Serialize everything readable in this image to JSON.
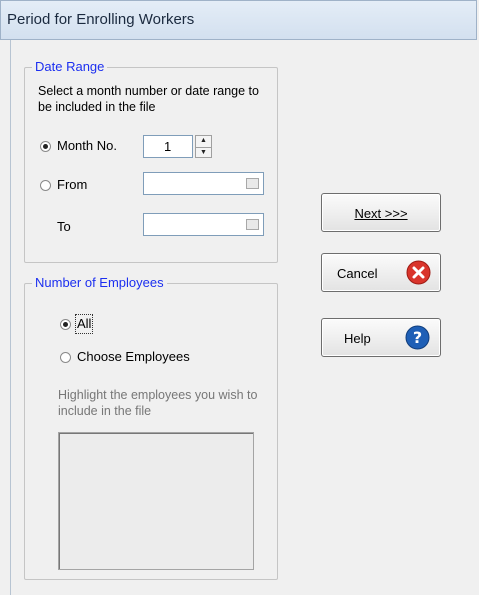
{
  "window": {
    "title": "Period for Enrolling Workers"
  },
  "date_range": {
    "legend": "Date Range",
    "instruction": "Select a month number or date range to be included in the file",
    "month_no_label": "Month No.",
    "month_no_value": "1",
    "from_label": "From",
    "to_label": "To",
    "from_value": "",
    "to_value": ""
  },
  "employees": {
    "legend": "Number of Employees",
    "all_label": "All",
    "choose_label": "Choose Employees",
    "hint": "Highlight the employees you wish to include in the file"
  },
  "buttons": {
    "next_label": "Next >>>",
    "cancel_label": "Cancel",
    "help_label": "Help"
  },
  "icons": {
    "cancel": "cancel-x-icon",
    "help": "help-question-icon",
    "calendar": "calendar-icon"
  },
  "colors": {
    "legend": "#1c2ff0",
    "cancel_icon": "#d9342b",
    "help_icon": "#1e5fb6"
  }
}
